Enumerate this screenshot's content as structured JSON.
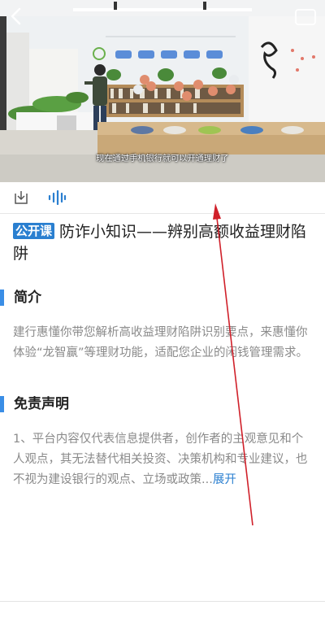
{
  "video": {
    "subtitle": "现在通过手机银行就可以开通理财了",
    "back_icon": "chevron-left-icon",
    "corner_icon": "screen-icon"
  },
  "toolbar": {
    "download_icon": "download-icon",
    "audio_icon": "audio-wave-icon"
  },
  "article": {
    "badge": "公开课",
    "title": "防诈小知识——辨别高额收益理财陷阱"
  },
  "intro": {
    "heading": "简介",
    "text": "建行惠懂你带您解析高收益理财陷阱识别要点，来惠懂你体验“龙智赢”等理财功能，适配您企业的闲钱管理需求。"
  },
  "disclaimer": {
    "heading": "免责声明",
    "text": "1、平台内容仅代表信息提供者，创作者的主观意见和个人观点，其无法替代相关投资、决策机构和专业建议，也不视为建设银行的观点、立场或政策...",
    "more_label": "展开"
  },
  "colors": {
    "accent": "#2a7fd0",
    "section_bar": "#3a8ee6",
    "annotation": "#d0202a"
  }
}
